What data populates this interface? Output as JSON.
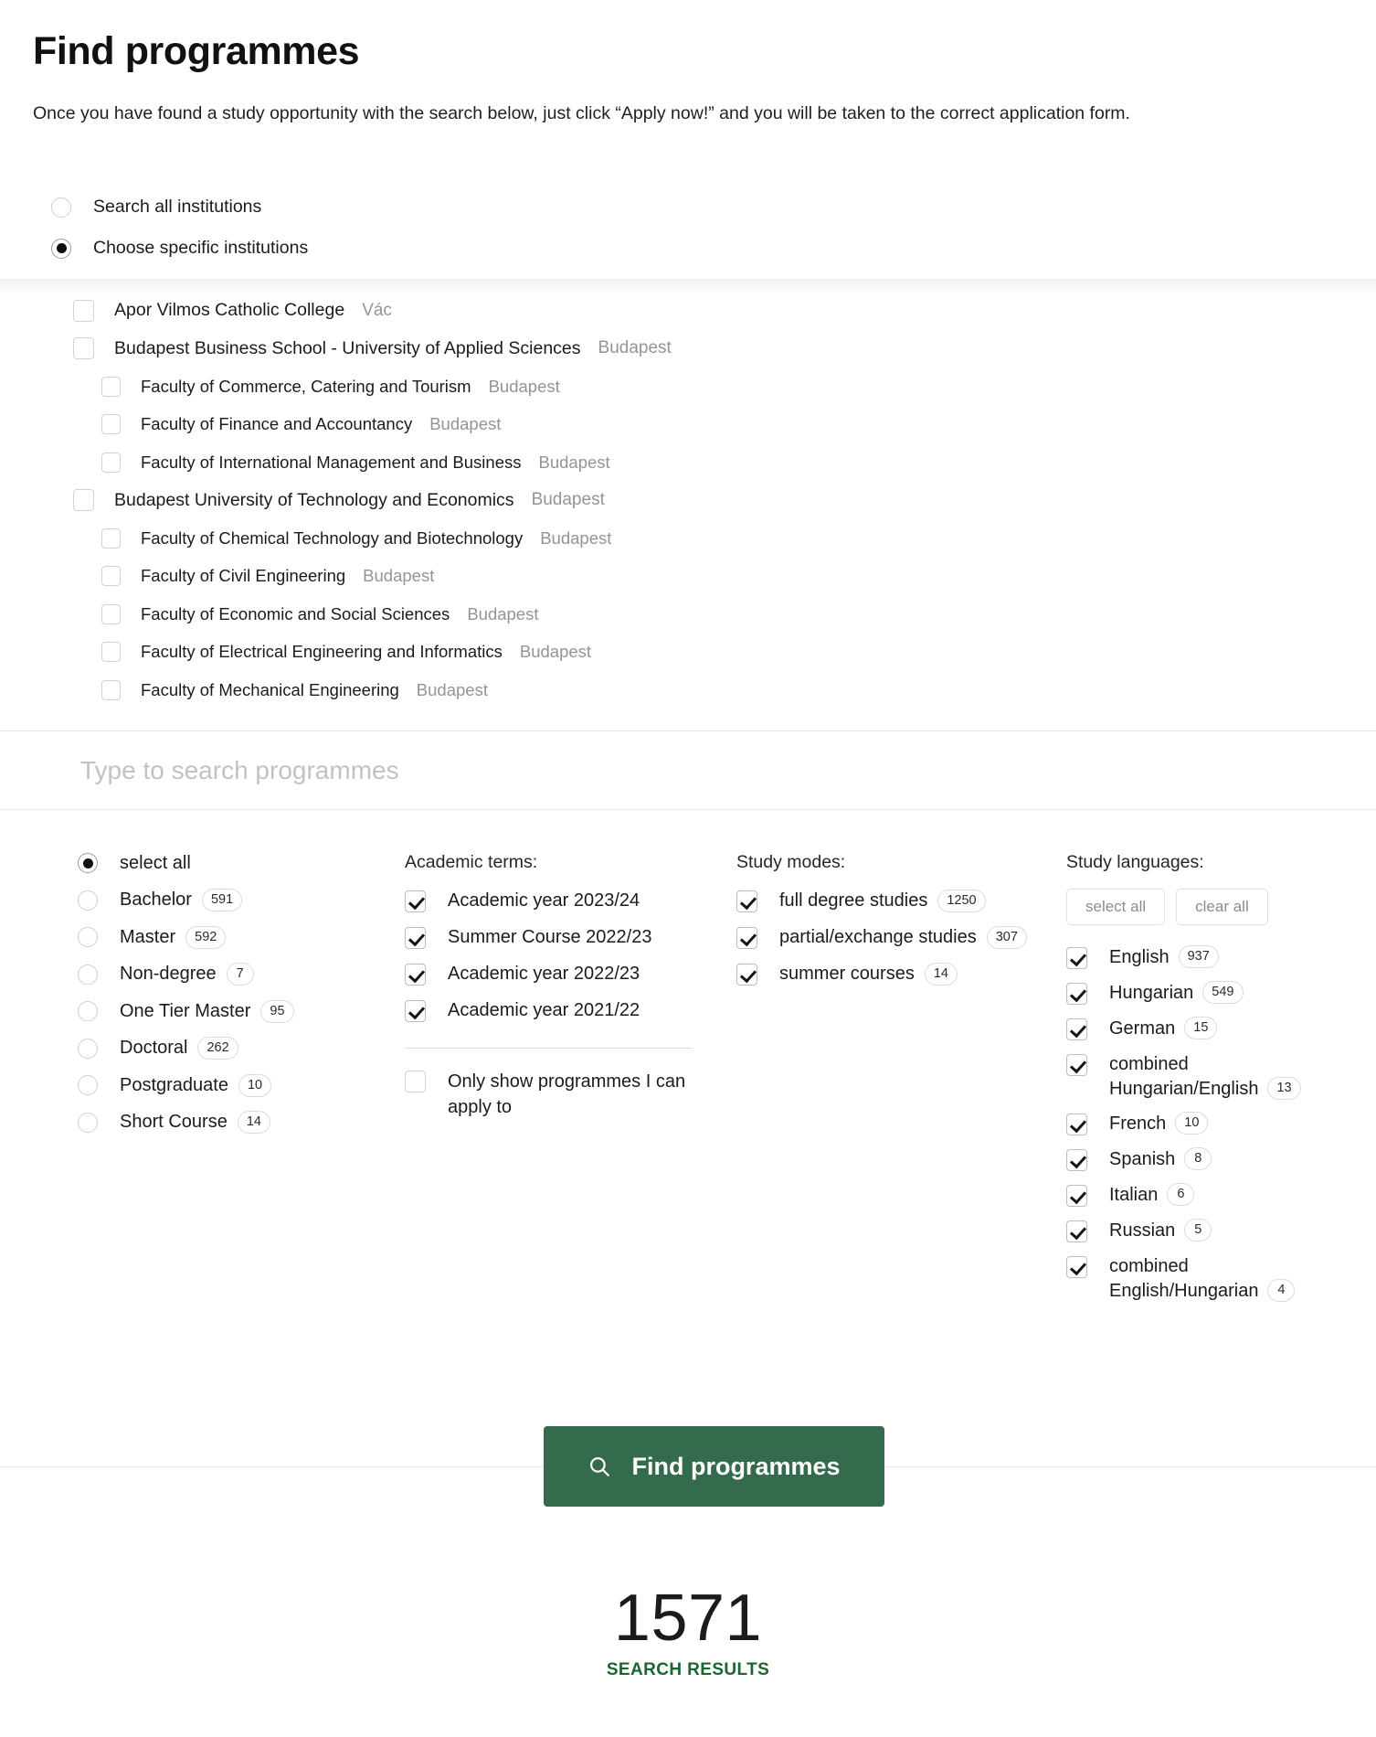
{
  "header": {
    "title": "Find programmes",
    "intro": "Once you have found a study opportunity with the search below, just click “Apply now!” and you will be taken to the correct application form."
  },
  "scope": {
    "options": [
      {
        "label": "Search all institutions",
        "selected": false
      },
      {
        "label": "Choose specific institutions",
        "selected": true
      }
    ]
  },
  "institutions": {
    "rows": [
      {
        "level": 1,
        "name": "Apor Vilmos Catholic College",
        "city": "Vác",
        "checked": false
      },
      {
        "level": 1,
        "name": "Budapest Business School - University of Applied Sciences",
        "city": "Budapest",
        "checked": false
      },
      {
        "level": 2,
        "name": "Faculty of Commerce, Catering and Tourism",
        "city": "Budapest",
        "checked": false
      },
      {
        "level": 2,
        "name": "Faculty of Finance and Accountancy",
        "city": "Budapest",
        "checked": false
      },
      {
        "level": 2,
        "name": "Faculty of International Management and Business",
        "city": "Budapest",
        "checked": false
      },
      {
        "level": 1,
        "name": "Budapest University of Technology and Economics",
        "city": "Budapest",
        "checked": false
      },
      {
        "level": 2,
        "name": "Faculty of Chemical Technology and Biotechnology",
        "city": "Budapest",
        "checked": false
      },
      {
        "level": 2,
        "name": "Faculty of Civil Engineering",
        "city": "Budapest",
        "checked": false
      },
      {
        "level": 2,
        "name": "Faculty of Economic and Social Sciences",
        "city": "Budapest",
        "checked": false
      },
      {
        "level": 2,
        "name": "Faculty of Electrical Engineering and Informatics",
        "city": "Budapest",
        "checked": false
      },
      {
        "level": 2,
        "name": "Faculty of Mechanical Engineering",
        "city": "Budapest",
        "checked": false
      }
    ]
  },
  "search": {
    "value": "",
    "placeholder": "Type to search programmes"
  },
  "levels": {
    "options": [
      {
        "label": "select all",
        "count": null,
        "selected": true
      },
      {
        "label": "Bachelor",
        "count": "591",
        "selected": false
      },
      {
        "label": "Master",
        "count": "592",
        "selected": false
      },
      {
        "label": "Non-degree",
        "count": "7",
        "selected": false
      },
      {
        "label": "One Tier Master",
        "count": "95",
        "selected": false
      },
      {
        "label": "Doctoral",
        "count": "262",
        "selected": false
      },
      {
        "label": "Postgraduate",
        "count": "10",
        "selected": false
      },
      {
        "label": "Short Course",
        "count": "14",
        "selected": false
      }
    ]
  },
  "terms": {
    "heading": "Academic terms:",
    "options": [
      {
        "label": "Academic year 2023/24",
        "checked": true
      },
      {
        "label": "Summer Course 2022/23",
        "checked": true
      },
      {
        "label": "Academic year 2022/23",
        "checked": true
      },
      {
        "label": "Academic year 2021/22",
        "checked": true
      }
    ],
    "apply_only": {
      "label": "Only show programmes I can apply to",
      "checked": false
    }
  },
  "modes": {
    "heading": "Study modes:",
    "options": [
      {
        "label": "full degree studies",
        "count": "1250",
        "checked": true
      },
      {
        "label": "partial/exchange studies",
        "count": "307",
        "checked": true
      },
      {
        "label": "summer courses",
        "count": "14",
        "checked": true
      }
    ]
  },
  "languages": {
    "heading": "Study languages:",
    "select_all_label": "select all",
    "clear_all_label": "clear all",
    "options": [
      {
        "label": "English",
        "count": "937",
        "checked": true
      },
      {
        "label": "Hungarian",
        "count": "549",
        "checked": true
      },
      {
        "label": "German",
        "count": "15",
        "checked": true
      },
      {
        "label": "combined Hungarian/English",
        "count": "13",
        "checked": true
      },
      {
        "label": "French",
        "count": "10",
        "checked": true
      },
      {
        "label": "Spanish",
        "count": "8",
        "checked": true
      },
      {
        "label": "Italian",
        "count": "6",
        "checked": true
      },
      {
        "label": "Russian",
        "count": "5",
        "checked": true
      },
      {
        "label": "combined English/Hungarian",
        "count": "4",
        "checked": true
      }
    ]
  },
  "submit": {
    "label": "Find programmes",
    "icon": "search-icon",
    "color": "#356b4d"
  },
  "results": {
    "count": "1571",
    "caption": "SEARCH RESULTS",
    "caption_color": "#19662f"
  }
}
